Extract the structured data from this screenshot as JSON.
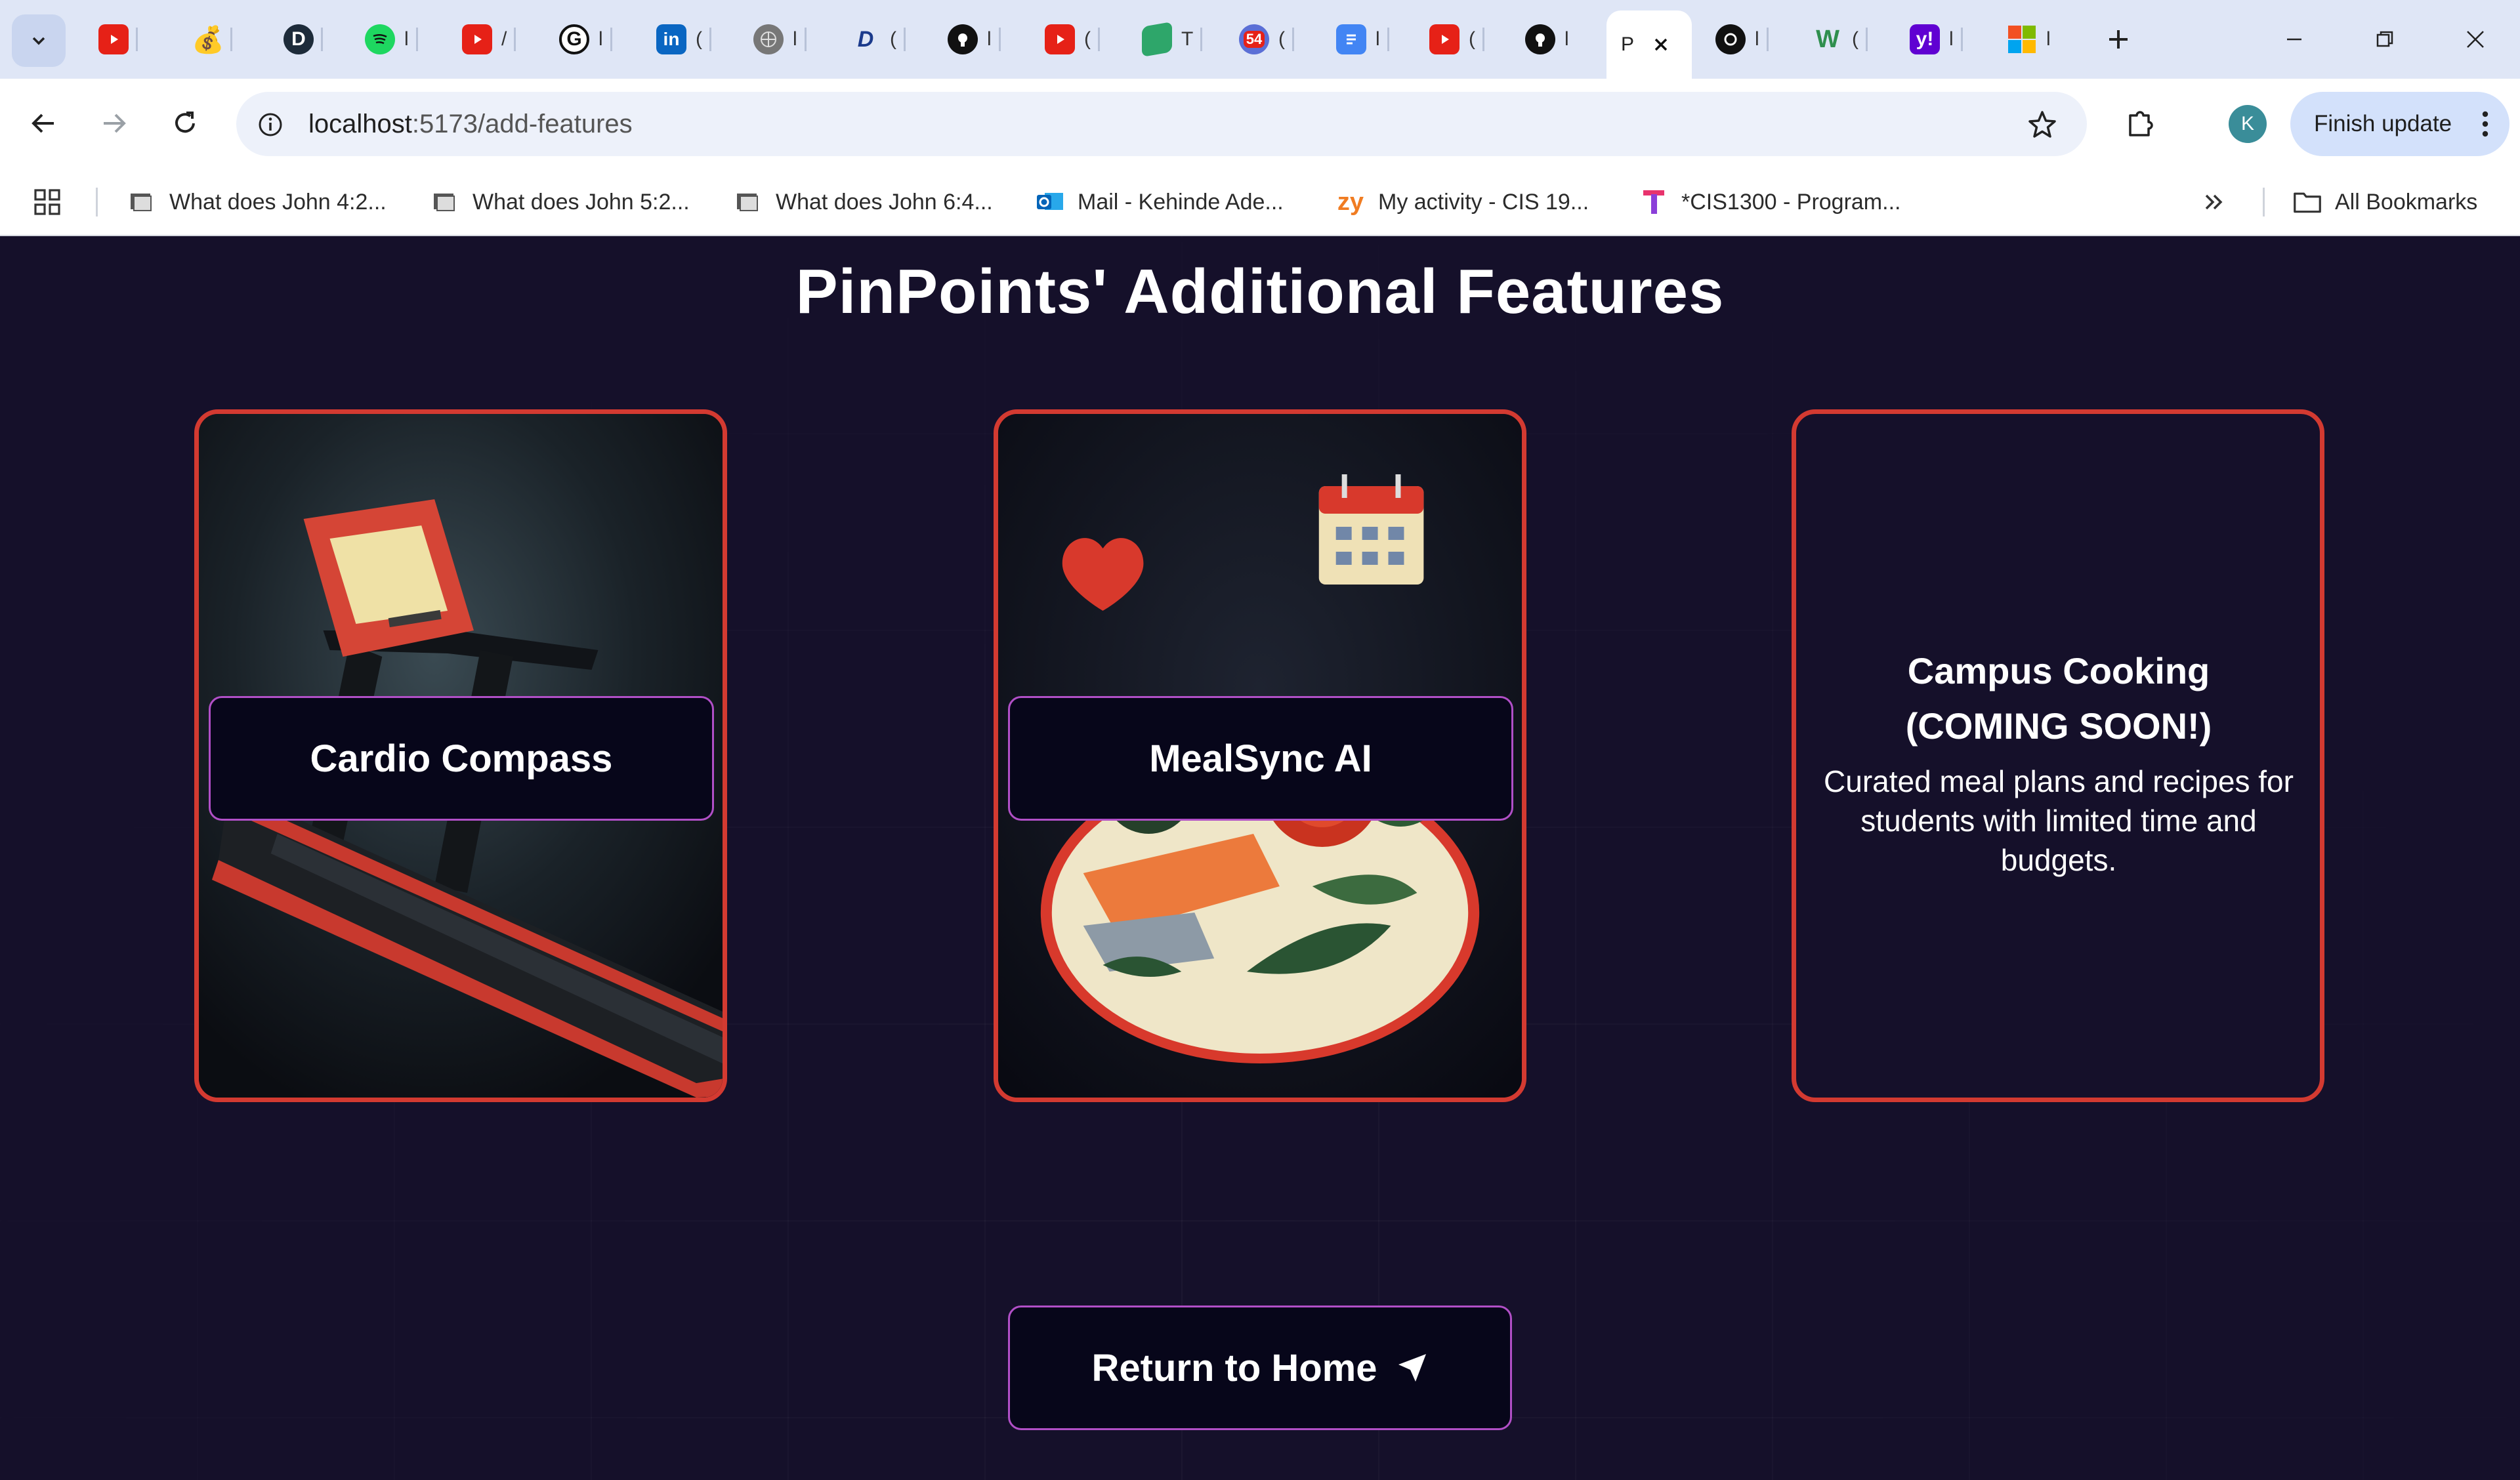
{
  "browser": {
    "tabs": [
      {
        "icon": "youtube-icon",
        "title": ""
      },
      {
        "icon": "money-bag-icon",
        "title": ""
      },
      {
        "icon": "d-logo-icon",
        "title": ""
      },
      {
        "icon": "spotify-icon",
        "title": "l"
      },
      {
        "icon": "youtube-icon",
        "title": "/"
      },
      {
        "icon": "g-logo-icon",
        "title": "l"
      },
      {
        "icon": "linkedin-icon",
        "title": "("
      },
      {
        "icon": "globe-icon",
        "title": "l"
      },
      {
        "icon": "disney-icon",
        "title": "("
      },
      {
        "icon": "github-icon",
        "title": "l"
      },
      {
        "icon": "youtube-icon",
        "title": "("
      },
      {
        "icon": "graduation-cap-icon",
        "title": "T"
      },
      {
        "icon": "calendar-badge-icon",
        "badge": "54",
        "title": "("
      },
      {
        "icon": "docs-icon",
        "title": "l"
      },
      {
        "icon": "youtube-icon",
        "title": "("
      },
      {
        "icon": "github-icon",
        "title": "l"
      }
    ],
    "active_tab": {
      "title": "P"
    },
    "tabs_after": [
      {
        "icon": "openai-icon",
        "title": "l"
      },
      {
        "icon": "w3-icon",
        "title": "("
      },
      {
        "icon": "yahoo-icon",
        "title": "l"
      },
      {
        "icon": "microsoft-icon",
        "title": "l"
      }
    ],
    "url_host": "localhost",
    "url_path": ":5173/add-features",
    "profile_initial": "K",
    "finish_update_label": "Finish update",
    "bookmarks": [
      {
        "icon": "bible-icon",
        "label": "What does John 4:2..."
      },
      {
        "icon": "bible-icon",
        "label": "What does John 5:2..."
      },
      {
        "icon": "bible-icon",
        "label": "What does John 6:4..."
      },
      {
        "icon": "outlook-icon",
        "label": "Mail - Kehinde Ade..."
      },
      {
        "icon": "zybooks-icon",
        "label": "My activity - CIS 19..."
      },
      {
        "icon": "t-logo-icon",
        "label": "*CIS1300 - Program..."
      }
    ],
    "all_bookmarks_label": "All Bookmarks"
  },
  "page": {
    "title": "PinPoints' Additional Features",
    "cards": [
      {
        "label": "Cardio Compass",
        "image": "treadmill-illustration"
      },
      {
        "label": "MealSync AI",
        "image": "meal-plate-illustration"
      },
      {
        "title_line1": "Campus Cooking",
        "title_line2": "(COMING SOON!)",
        "description": "Curated meal plans and recipes for students with limited time and budgets."
      }
    ],
    "return_label": "Return to Home",
    "colors": {
      "background": "#15102a",
      "card_border": "#d33a31",
      "button_border": "#b14fc7",
      "button_bg": "#07061a"
    }
  }
}
